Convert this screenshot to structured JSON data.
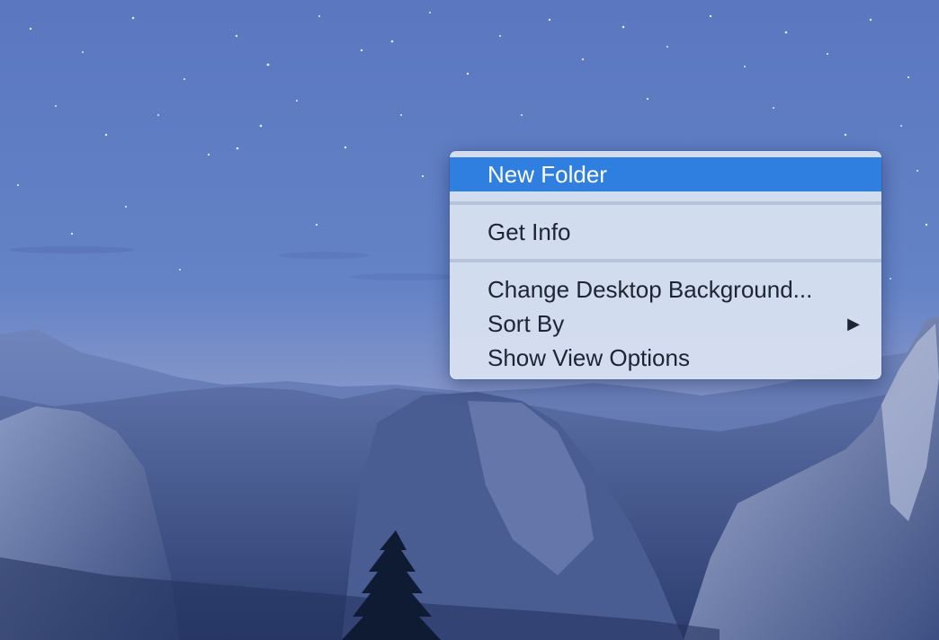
{
  "context_menu": {
    "items": [
      {
        "label": "New Folder"
      },
      {
        "label": "Get Info"
      },
      {
        "label": "Change Desktop Background..."
      },
      {
        "label": "Sort By",
        "submenu_icon": "triangle-right-icon"
      },
      {
        "label": "Show View Options"
      }
    ],
    "highlight_color": "#2f7fe0"
  },
  "wallpaper": {
    "description_icon": "yosemite-wallpaper"
  }
}
